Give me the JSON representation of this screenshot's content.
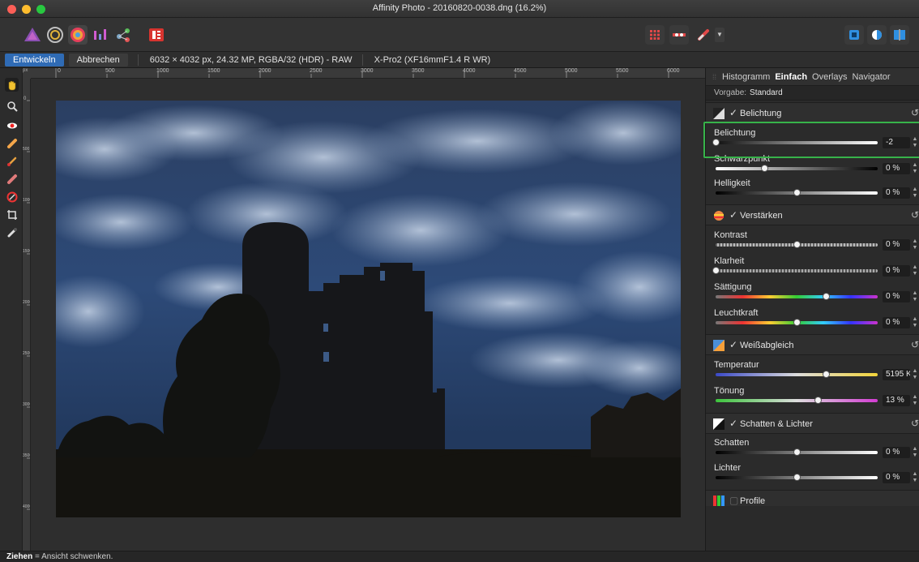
{
  "window": {
    "title": "Affinity Photo - 20160820-0038.dng (16.2%)"
  },
  "toolbar": {
    "personas": [
      "photo-persona-icon",
      "liquify-persona-icon",
      "develop-persona-icon",
      "tone-mapping-persona-icon",
      "export-persona-icon"
    ],
    "right_icons": [
      "grid-icon",
      "overlay-icon",
      "brush-icon",
      "split-view-icon",
      "mirror-view-icon",
      "compare-view-icon"
    ]
  },
  "context": {
    "develop_label": "Entwickeln",
    "cancel_label": "Abbrechen",
    "image_info": "6032 × 4032 px, 24.32 MP, RGBA/32 (HDR) - RAW",
    "camera_info": "X-Pro2 (XF16mmF1.4 R WR)"
  },
  "ruler": {
    "unit": "px",
    "h_ticks": [
      "0",
      "500",
      "1000",
      "1500",
      "2000",
      "2500",
      "3000",
      "3500",
      "4000",
      "4500",
      "5000",
      "5500",
      "6000"
    ],
    "v_ticks": [
      "0",
      "500",
      "1000",
      "1500",
      "2000",
      "2500",
      "3000",
      "3500",
      "4000"
    ]
  },
  "tools": [
    "hand-icon",
    "zoom-icon",
    "red-eye-icon",
    "blemish-icon",
    "brush-icon",
    "erase-brush-icon",
    "overlay-gradient-icon",
    "crop-icon",
    "white-balance-picker-icon"
  ],
  "panel": {
    "tabs": [
      "Histogramm",
      "Einfach",
      "Overlays",
      "Navigator"
    ],
    "active_tab": "Einfach",
    "preset_label": "Vorgabe:",
    "preset_value": "Standard",
    "sections": {
      "exposure": {
        "title": "Belichtung",
        "sliders": [
          {
            "label": "Belichtung",
            "value": "-2",
            "position": 0.0
          },
          {
            "label": "Schwarzpunkt",
            "value": "0 %",
            "position": 0.3
          },
          {
            "label": "Helligkeit",
            "value": "0 %",
            "position": 0.5
          }
        ]
      },
      "enhance": {
        "title": "Verstärken",
        "sliders": [
          {
            "label": "Kontrast",
            "value": "0 %",
            "position": 0.5
          },
          {
            "label": "Klarheit",
            "value": "0 %",
            "position": 0.0
          },
          {
            "label": "Sättigung",
            "value": "0 %",
            "position": 0.68
          },
          {
            "label": "Leuchtkraft",
            "value": "0 %",
            "position": 0.5
          }
        ]
      },
      "white_balance": {
        "title": "Weißabgleich",
        "sliders": [
          {
            "label": "Temperatur",
            "value": "5195 K",
            "position": 0.68
          },
          {
            "label": "Tönung",
            "value": "13 %",
            "position": 0.63
          }
        ]
      },
      "shadows_highlights": {
        "title": "Schatten & Lichter",
        "sliders": [
          {
            "label": "Schatten",
            "value": "0 %",
            "position": 0.5
          },
          {
            "label": "Lichter",
            "value": "0 %",
            "position": 0.5
          }
        ]
      },
      "profiles": {
        "title": "Profile"
      }
    }
  },
  "status": {
    "action": "Ziehen",
    "description": " = Ansicht schwenken."
  },
  "colors": {
    "accent": "#2f6bb5",
    "highlight": "#37b34a"
  }
}
